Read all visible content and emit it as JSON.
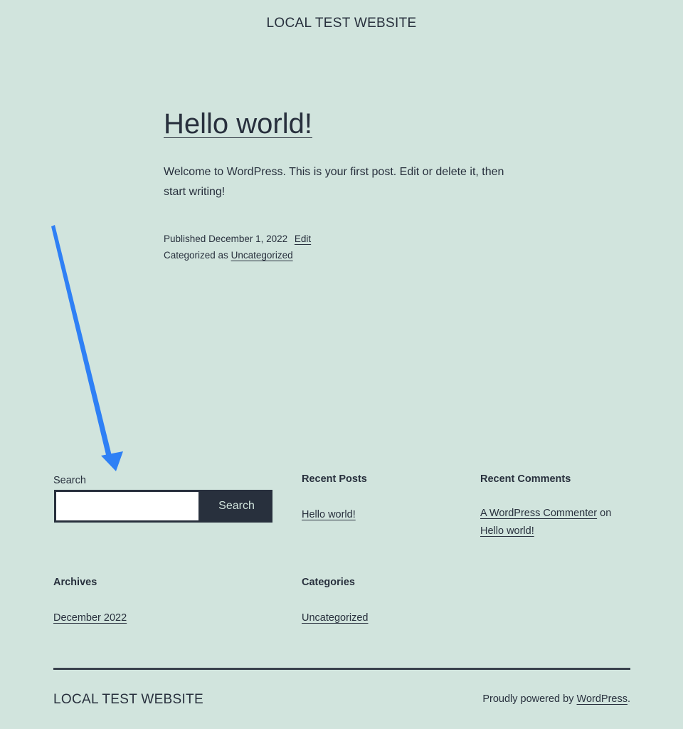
{
  "header": {
    "site_title": "LOCAL TEST WEBSITE"
  },
  "post": {
    "title": "Hello world!",
    "content": "Welcome to WordPress. This is your first post. Edit or delete it, then start writing!",
    "published_prefix": "Published",
    "published_date": "December 1, 2022",
    "edit_label": "Edit",
    "categorized_prefix": "Categorized as",
    "category": "Uncategorized"
  },
  "widgets": {
    "search": {
      "label": "Search",
      "button_label": "Search",
      "value": ""
    },
    "recent_posts": {
      "title": "Recent Posts",
      "items": [
        "Hello world!"
      ]
    },
    "recent_comments": {
      "title": "Recent Comments",
      "author": "A WordPress Commenter",
      "on": "on",
      "post": "Hello world!"
    },
    "archives": {
      "title": "Archives",
      "items": [
        "December 2022"
      ]
    },
    "categories": {
      "title": "Categories",
      "items": [
        "Uncategorized"
      ]
    }
  },
  "footer": {
    "site_title": "LOCAL TEST WEBSITE",
    "powered_prefix": "Proudly powered by",
    "powered_link": "WordPress",
    "powered_suffix": "."
  },
  "colors": {
    "background": "#d1e4dd",
    "text": "#28303d",
    "annotation_arrow": "#2f80f5"
  },
  "icons": {
    "annotation": "arrow-annotation-icon"
  }
}
